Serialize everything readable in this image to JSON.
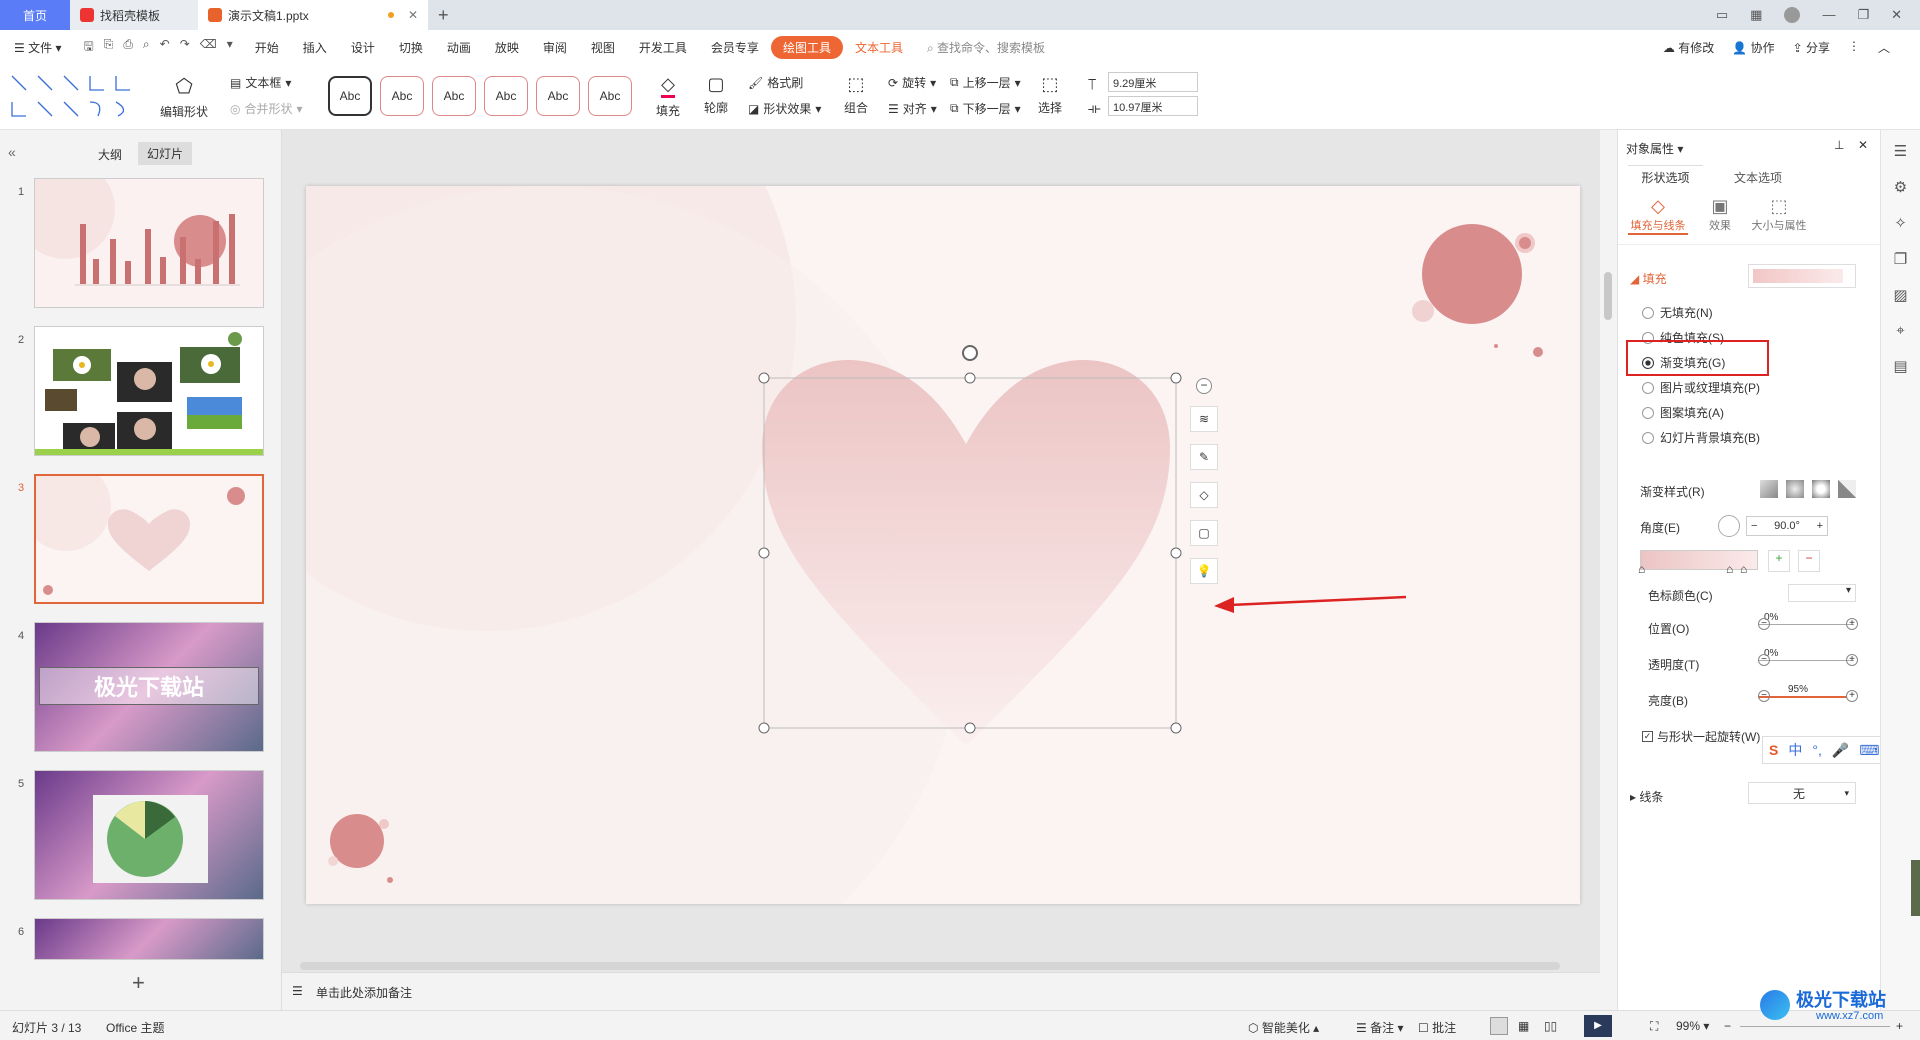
{
  "titlebar": {
    "home_tab": "首页",
    "templates_tab": "找稻壳模板",
    "doc_tab": "演示文稿1.pptx",
    "new_tab": "+"
  },
  "menubar": {
    "file": "文件",
    "items": [
      "开始",
      "插入",
      "设计",
      "切换",
      "动画",
      "放映",
      "审阅",
      "视图",
      "开发工具",
      "会员专享"
    ],
    "drawing_tools": "绘图工具",
    "text_tools": "文本工具",
    "search": "查找命令、搜索模板",
    "modified": "有修改",
    "collab": "协作",
    "share": "分享"
  },
  "ribbon": {
    "edit_shape": "编辑形状",
    "text_box": "文本框",
    "merge_shape": "合并形状",
    "style_label": "Abc",
    "fill": "填充",
    "outline": "轮廓",
    "format_painter": "格式刷",
    "shape_effect": "形状效果",
    "group": "组合",
    "rotate": "旋转",
    "align": "对齐",
    "bring_forward": "上移一层",
    "send_backward": "下移一层",
    "select": "选择",
    "height": "9.29厘米",
    "width": "10.97厘米"
  },
  "leftpanel": {
    "outline_tab": "大纲",
    "slides_tab": "幻灯片",
    "slide_numbers": [
      "1",
      "2",
      "3",
      "4",
      "5",
      "6"
    ],
    "slide4_text": "极光下载站",
    "add": "+"
  },
  "canvas": {
    "notes_placeholder": "单击此处添加备注"
  },
  "rightpanel": {
    "title": "对象属性",
    "tab_shape": "形状选项",
    "tab_text": "文本选项",
    "sub_fill_line": "填充与线条",
    "sub_effect": "效果",
    "sub_size": "大小与属性",
    "fill_section": "填充",
    "options": [
      "无填充(N)",
      "纯色填充(S)",
      "渐变填充(G)",
      "图片或纹理填充(P)",
      "图案填充(A)",
      "幻灯片背景填充(B)"
    ],
    "selected_option": "渐变填充(G)",
    "gradient_style": "渐变样式(R)",
    "angle_label": "角度(E)",
    "angle_value": "90.0°",
    "stop_color": "色标颜色(C)",
    "position": "位置(O)",
    "position_value": "0%",
    "transparency": "透明度(T)",
    "transparency_value": "0%",
    "brightness": "亮度(B)",
    "brightness_value": "95%",
    "rotate_with_shape": "与形状一起旋转(W)",
    "line_section": "线条",
    "line_value": "无"
  },
  "statusbar": {
    "slide_info": "幻灯片 3 / 13",
    "theme": "Office 主题",
    "beautify": "智能美化",
    "notes": "备注",
    "comments": "批注",
    "zoom": "99%"
  },
  "ime": {
    "lang": "中"
  },
  "watermark": {
    "name": "极光下载站",
    "url": "www.xz7.com"
  },
  "colors": {
    "accent": "#ee6633",
    "home_tab": "#5b7cf7",
    "highlight_box": "#d22222",
    "pink": "#d98c8c"
  }
}
